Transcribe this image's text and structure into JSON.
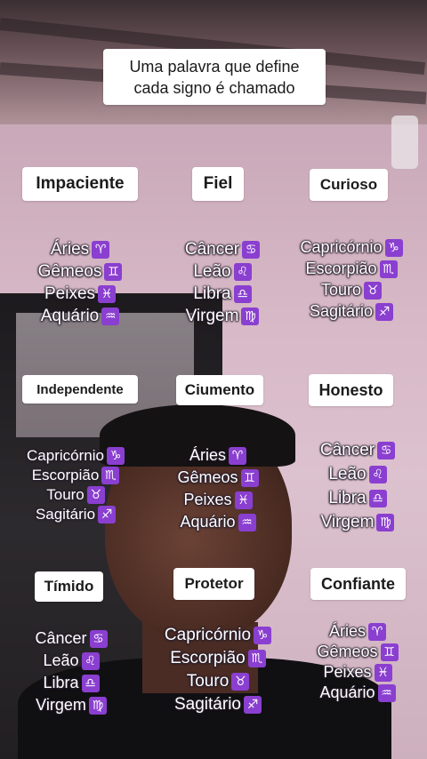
{
  "title": {
    "line1": "Uma palavra que define",
    "line2": "cada signo é chamado"
  },
  "groups": [
    {
      "label": "Impaciente",
      "signs": [
        {
          "name": "Áries",
          "symbol": "♈"
        },
        {
          "name": "Gêmeos",
          "symbol": "♊"
        },
        {
          "name": "Peixes",
          "symbol": "♓"
        },
        {
          "name": "Aquário",
          "symbol": "♒"
        }
      ]
    },
    {
      "label": "Fiel",
      "signs": [
        {
          "name": "Câncer",
          "symbol": "♋"
        },
        {
          "name": "Leão",
          "symbol": "♌"
        },
        {
          "name": "Libra",
          "symbol": "♎"
        },
        {
          "name": "Virgem",
          "symbol": "♍"
        }
      ]
    },
    {
      "label": "Curioso",
      "signs": [
        {
          "name": "Capricórnio",
          "symbol": "♑"
        },
        {
          "name": "Escorpião",
          "symbol": "♏"
        },
        {
          "name": "Touro",
          "symbol": "♉"
        },
        {
          "name": "Sagitário",
          "symbol": "♐"
        }
      ]
    },
    {
      "label": "Independente",
      "signs": [
        {
          "name": "Capricórnio",
          "symbol": "♑"
        },
        {
          "name": "Escorpião",
          "symbol": "♏"
        },
        {
          "name": "Touro",
          "symbol": "♉"
        },
        {
          "name": "Sagitário",
          "symbol": "♐"
        }
      ]
    },
    {
      "label": "Ciumento",
      "signs": [
        {
          "name": "Áries",
          "symbol": "♈"
        },
        {
          "name": "Gêmeos",
          "symbol": "♊"
        },
        {
          "name": "Peixes",
          "symbol": "♓"
        },
        {
          "name": "Aquário",
          "symbol": "♒"
        }
      ]
    },
    {
      "label": "Honesto",
      "signs": [
        {
          "name": "Câncer",
          "symbol": "♋"
        },
        {
          "name": "Leão",
          "symbol": "♌"
        },
        {
          "name": "Libra",
          "symbol": "♎"
        },
        {
          "name": "Virgem",
          "symbol": "♍"
        }
      ]
    },
    {
      "label": "Tímido",
      "signs": [
        {
          "name": "Câncer",
          "symbol": "♋"
        },
        {
          "name": "Leão",
          "symbol": "♌"
        },
        {
          "name": "Libra",
          "symbol": "♎"
        },
        {
          "name": "Virgem",
          "symbol": "♍"
        }
      ]
    },
    {
      "label": "Protetor",
      "signs": [
        {
          "name": "Capricórnio",
          "symbol": "♑"
        },
        {
          "name": "Escorpião",
          "symbol": "♏"
        },
        {
          "name": "Touro",
          "symbol": "♉"
        },
        {
          "name": "Sagitário",
          "symbol": "♐"
        }
      ]
    },
    {
      "label": "Confiante",
      "signs": [
        {
          "name": "Áries",
          "symbol": "♈"
        },
        {
          "name": "Gêmeos",
          "symbol": "♊"
        },
        {
          "name": "Peixes",
          "symbol": "♓"
        },
        {
          "name": "Aquário",
          "symbol": "♒"
        }
      ]
    }
  ],
  "colors": {
    "glyph_bg": "#8a3fd0",
    "label_bg": "#ffffff",
    "sign_text": "#ffffff"
  }
}
